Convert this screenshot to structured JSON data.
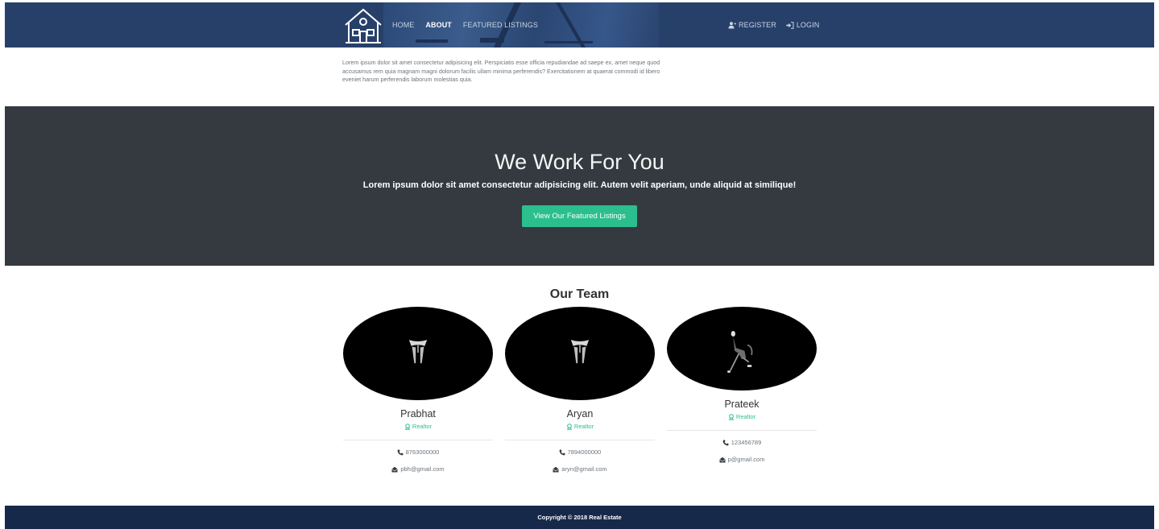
{
  "nav": {
    "links": [
      {
        "label": "HOME",
        "active": false
      },
      {
        "label": "ABOUT",
        "active": true
      },
      {
        "label": "FEATURED LISTINGS",
        "active": false
      }
    ],
    "register_label": "REGISTER",
    "login_label": "LOGIN",
    "logo_icon": "house-icon",
    "register_icon": "user-plus-icon",
    "login_icon": "sign-in-icon"
  },
  "about": {
    "text": "Lorem ipsum dolor sit amet consectetur adipisicing elit. Perspiciatis esse officia repudiandae ad saepe ex, amet neque quod accusamus rem quia magnam magni dolorum facilis ullam minima perferendis? Exercitationem at quaerat commodi id libero eveniet harum perferendis laborum molestias quia."
  },
  "hero": {
    "title": "We Work For You",
    "subtitle": "Lorem ipsum dolor sit amet consectetur adipisicing elit. Autem velit aperiam, unde aliquid at similique!",
    "button_label": "View Our Featured Listings"
  },
  "team": {
    "title": "Our Team",
    "members": [
      {
        "name": "Prabhat",
        "role": "Realtor",
        "phone": "8763000000",
        "email": "pbh@gmail.com"
      },
      {
        "name": "Aryan",
        "role": "Realtor",
        "phone": "7894000000",
        "email": "aryn@gmail.com"
      },
      {
        "name": "Prateek",
        "role": "Realtor",
        "phone": "123456789",
        "email": "p@gmail.com"
      }
    ]
  },
  "footer": {
    "copyright": "Copyright © 2018 Real Estate"
  },
  "colors": {
    "navbar": "#27406a",
    "hero": "#343a40",
    "accent": "#2bbf8d",
    "footer": "#17294a"
  }
}
